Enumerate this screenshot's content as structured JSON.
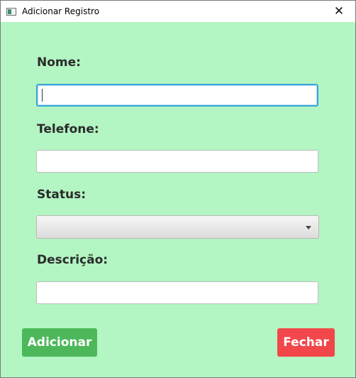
{
  "window": {
    "title": "Adicionar Registro",
    "close_glyph": "✕",
    "background_color": "#b3f5c3"
  },
  "form": {
    "nome_label": "Nome:",
    "nome_value": "",
    "telefone_label": "Telefone:",
    "telefone_value": "",
    "status_label": "Status:",
    "status_selected": "",
    "descricao_label": "Descrição:",
    "descricao_value": ""
  },
  "buttons": {
    "add_label": "Adicionar",
    "add_color": "#4cb85a",
    "close_label": "Fechar",
    "close_color": "#f2474a"
  },
  "icons": {
    "app": "app-window-icon",
    "close": "close-icon",
    "dropdown": "chevron-down-icon"
  }
}
